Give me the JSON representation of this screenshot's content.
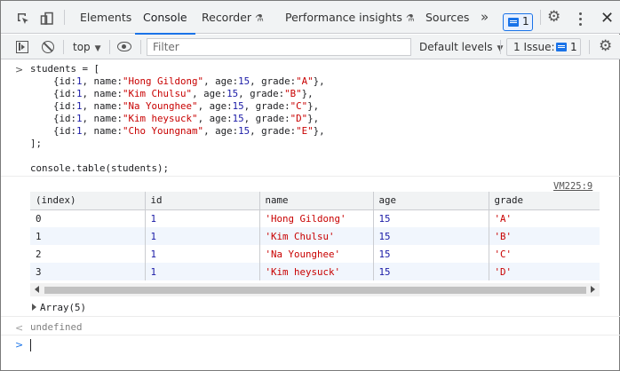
{
  "tabs": {
    "items": [
      {
        "label": "Elements"
      },
      {
        "label": "Console"
      },
      {
        "label": "Recorder",
        "flask": "⚗"
      },
      {
        "label": "Performance insights",
        "flask": "⚗"
      },
      {
        "label": "Sources"
      }
    ],
    "active": "Console",
    "overflow": "»",
    "message_count": "1"
  },
  "toolbar": {
    "context": "top",
    "filter_placeholder": "Filter",
    "levels_label": "Default levels",
    "issues_label": "1 Issue:",
    "issues_count": "1"
  },
  "console": {
    "prompt": ">",
    "code_lines": [
      [
        {
          "t": "students = ["
        }
      ],
      [
        {
          "t": "    {id:"
        },
        {
          "t": "1",
          "c": "num"
        },
        {
          "t": ", name:"
        },
        {
          "t": "\"Hong Gildong\"",
          "c": "str"
        },
        {
          "t": ", age:"
        },
        {
          "t": "15",
          "c": "num"
        },
        {
          "t": ", grade:"
        },
        {
          "t": "\"A\"",
          "c": "str"
        },
        {
          "t": "},"
        }
      ],
      [
        {
          "t": "    {id:"
        },
        {
          "t": "1",
          "c": "num"
        },
        {
          "t": ", name:"
        },
        {
          "t": "\"Kim Chulsu\"",
          "c": "str"
        },
        {
          "t": ", age:"
        },
        {
          "t": "15",
          "c": "num"
        },
        {
          "t": ", grade:"
        },
        {
          "t": "\"B\"",
          "c": "str"
        },
        {
          "t": "},"
        }
      ],
      [
        {
          "t": "    {id:"
        },
        {
          "t": "1",
          "c": "num"
        },
        {
          "t": ", name:"
        },
        {
          "t": "\"Na Younghee\"",
          "c": "str"
        },
        {
          "t": ", age:"
        },
        {
          "t": "15",
          "c": "num"
        },
        {
          "t": ", grade:"
        },
        {
          "t": "\"C\"",
          "c": "str"
        },
        {
          "t": "},"
        }
      ],
      [
        {
          "t": "    {id:"
        },
        {
          "t": "1",
          "c": "num"
        },
        {
          "t": ", name:"
        },
        {
          "t": "\"Kim heysuck\"",
          "c": "str"
        },
        {
          "t": ", age:"
        },
        {
          "t": "15",
          "c": "num"
        },
        {
          "t": ", grade:"
        },
        {
          "t": "\"D\"",
          "c": "str"
        },
        {
          "t": "},"
        }
      ],
      [
        {
          "t": "    {id:"
        },
        {
          "t": "1",
          "c": "num"
        },
        {
          "t": ", name:"
        },
        {
          "t": "\"Cho Youngnam\"",
          "c": "str"
        },
        {
          "t": ", age:"
        },
        {
          "t": "15",
          "c": "num"
        },
        {
          "t": ", grade:"
        },
        {
          "t": "\"E\"",
          "c": "str"
        },
        {
          "t": "},"
        }
      ],
      [
        {
          "t": "];"
        }
      ],
      [],
      [
        {
          "t": "console.table(students);"
        }
      ]
    ],
    "source_link": "VM225:9",
    "table": {
      "columns": [
        "(index)",
        "id",
        "name",
        "age",
        "grade"
      ],
      "rows": [
        [
          "0",
          "1",
          "'Hong Gildong'",
          "15",
          "'A'"
        ],
        [
          "1",
          "1",
          "'Kim Chulsu'",
          "15",
          "'B'"
        ],
        [
          "2",
          "1",
          "'Na Younghee'",
          "15",
          "'C'"
        ],
        [
          "3",
          "1",
          "'Kim heysuck'",
          "15",
          "'D'"
        ]
      ]
    },
    "array_summary": "Array(5)",
    "result_arrow": "<",
    "result": "undefined",
    "input_prompt": ">"
  },
  "colors": {
    "accent": "#1a73e8",
    "string": "#c80000",
    "number": "#1a1aa6"
  }
}
